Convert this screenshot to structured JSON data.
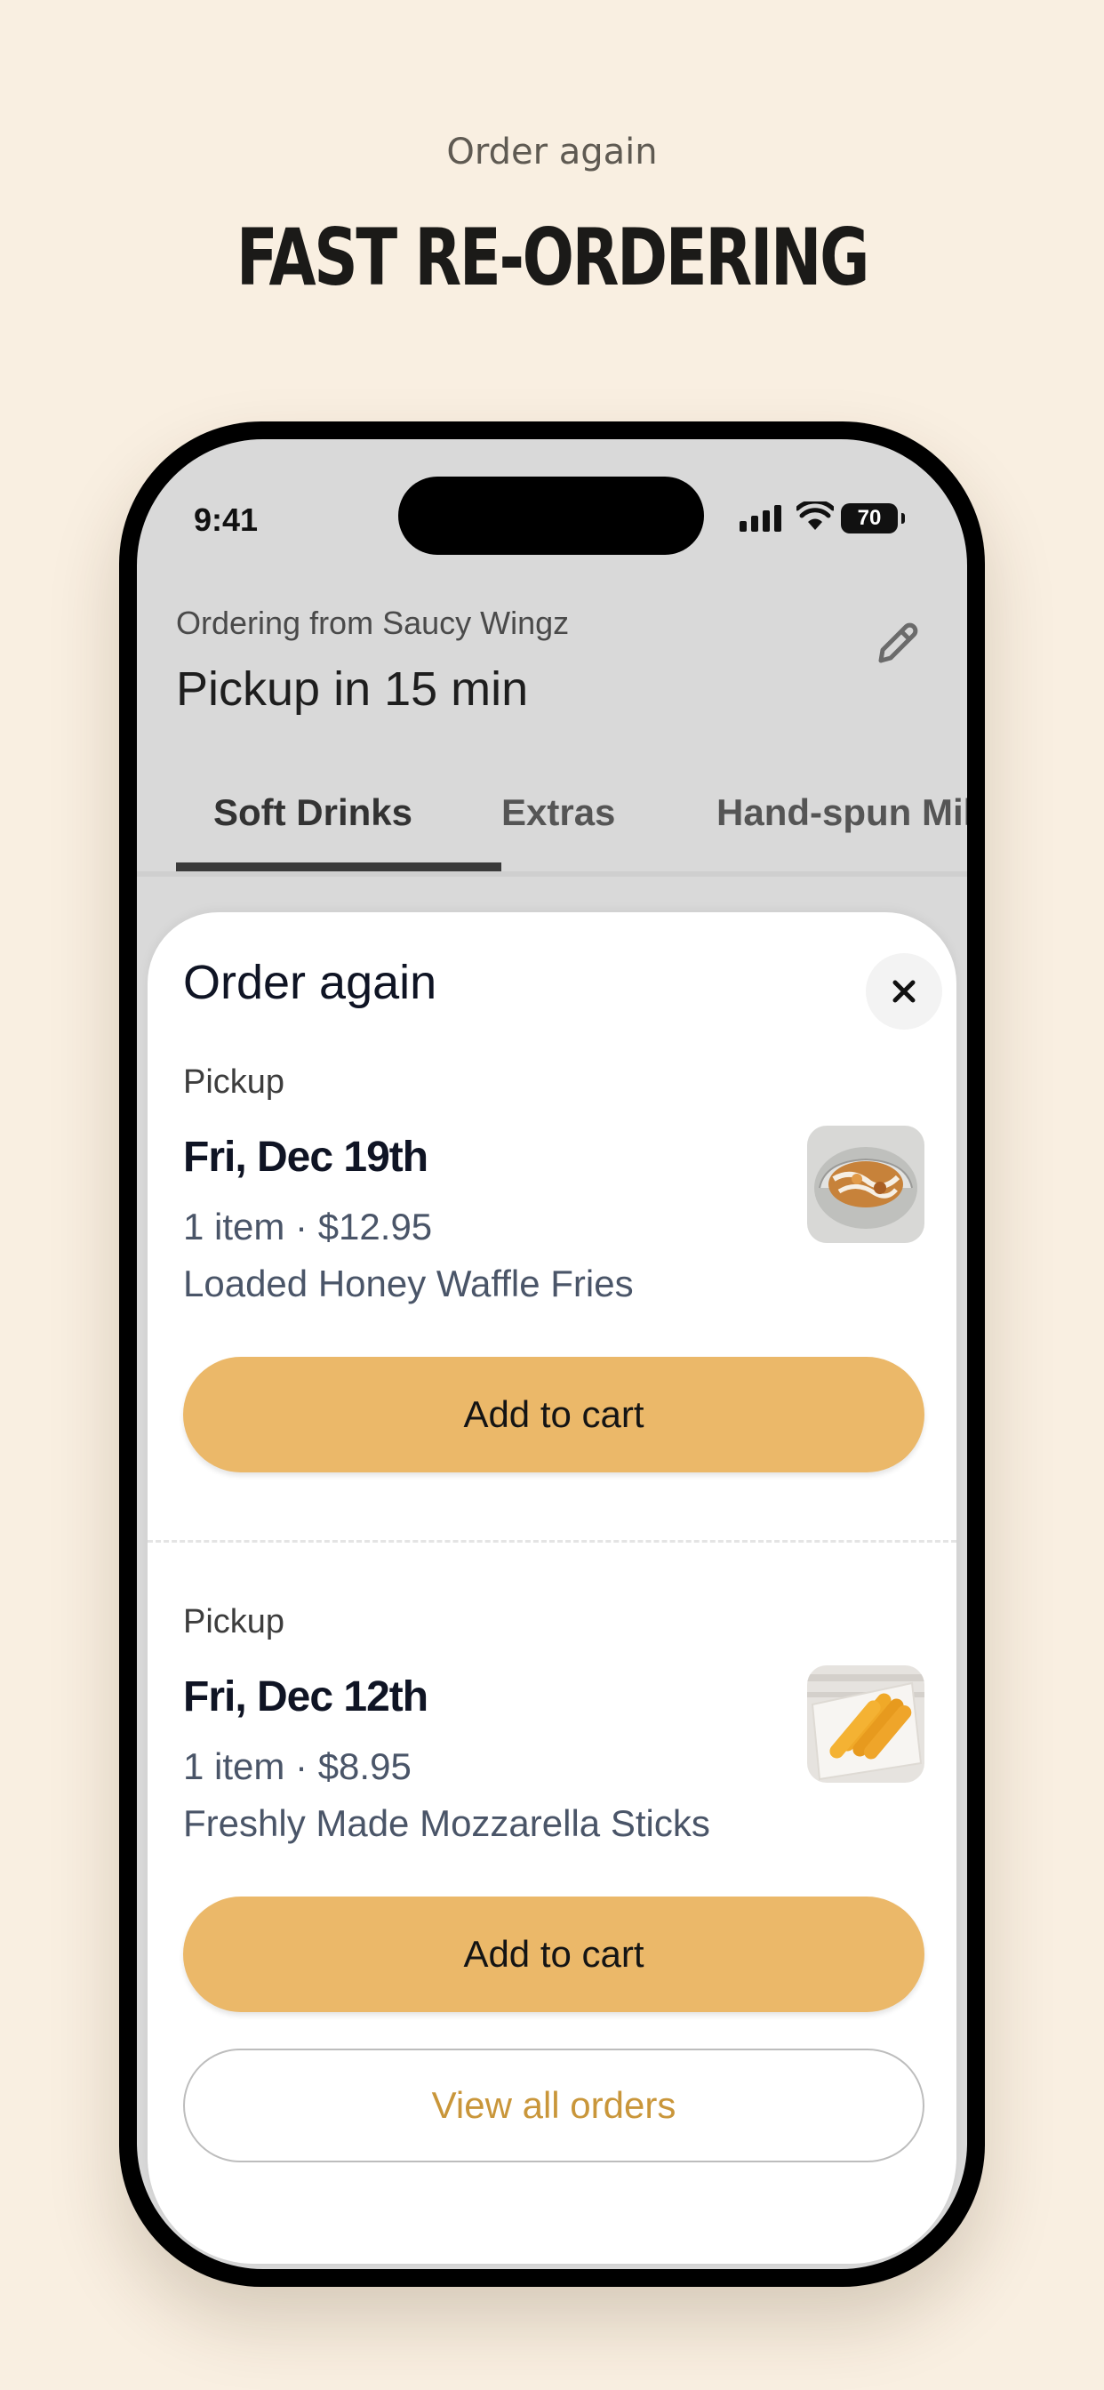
{
  "promo": {
    "subtitle": "Order again",
    "title": "FAST RE-ORDERING"
  },
  "status_bar": {
    "time": "9:41",
    "battery": "70",
    "icons": [
      "signal-icon",
      "wifi-icon",
      "battery-icon"
    ]
  },
  "header": {
    "ordering_from": "Ordering from Saucy Wingz",
    "pickup_eta": "Pickup in 15 min",
    "edit_icon": "pencil-icon"
  },
  "tabs": [
    {
      "label": "Soft Drinks",
      "active": true
    },
    {
      "label": "Extras",
      "active": false
    },
    {
      "label": "Hand-spun Mil",
      "active": false
    }
  ],
  "sheet": {
    "title": "Order again",
    "close_icon": "close-icon",
    "orders": [
      {
        "type": "Pickup",
        "date": "Fri, Dec 19th",
        "meta": "1 item · $12.95",
        "description": "Loaded Honey Waffle Fries",
        "add_label": "Add to cart"
      },
      {
        "type": "Pickup",
        "date": "Fri, Dec 12th",
        "meta": "1 item · $8.95",
        "description": "Freshly Made Mozzarella Sticks",
        "add_label": "Add to cart"
      }
    ],
    "view_all_label": "View all orders"
  },
  "colors": {
    "background": "#f9efe1",
    "accent_button": "#ebb869",
    "view_all_text": "#c9963a"
  }
}
